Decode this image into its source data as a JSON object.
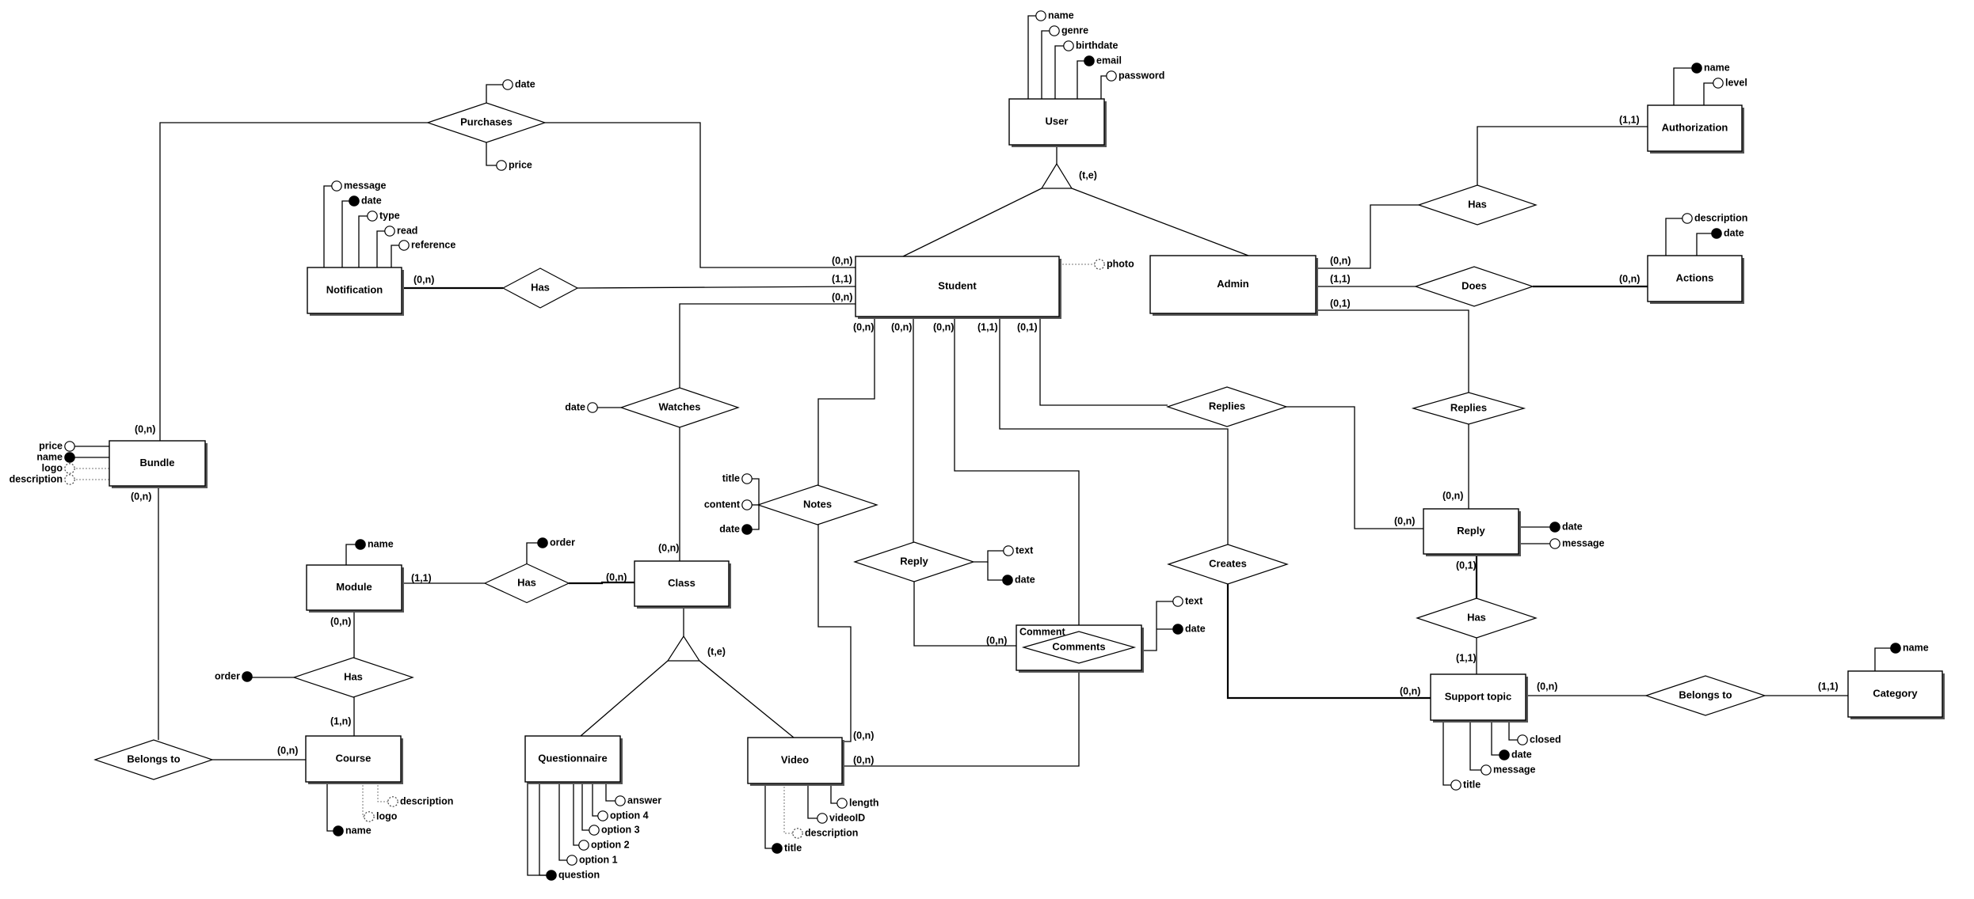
{
  "diagram": {
    "type": "Entity-Relationship diagram",
    "entities": {
      "user": "User",
      "student": "Student",
      "admin": "Admin",
      "authorization": "Authorization",
      "actions": "Actions",
      "notification": "Notification",
      "bundle": "Bundle",
      "module": "Module",
      "class": "Class",
      "course": "Course",
      "questionnaire": "Questionnaire",
      "video": "Video",
      "reply": "Reply",
      "support_topic": "Support topic",
      "category": "Category",
      "comment": "Comment"
    },
    "relationships": {
      "purchases": "Purchases",
      "has_notification": "Has",
      "watches": "Watches",
      "notes": "Notes",
      "has_module_class": "Has",
      "has_module_course": "Has",
      "belongs_to_bundle": "Belongs to",
      "reply_comment": "Reply",
      "comments": "Comments",
      "replies_student": "Replies",
      "replies_admin": "Replies",
      "creates": "Creates",
      "has_authorization": "Has",
      "does": "Does",
      "has_reply_topic": "Has",
      "belongs_to_category": "Belongs to"
    },
    "specializations": {
      "user": "(t,e)",
      "class": "(t,e)"
    },
    "attributes": {
      "user": [
        {
          "name": "name",
          "kind": "normal"
        },
        {
          "name": "genre",
          "kind": "normal"
        },
        {
          "name": "birthdate",
          "kind": "normal"
        },
        {
          "name": "email",
          "kind": "key"
        },
        {
          "name": "password",
          "kind": "normal"
        }
      ],
      "student": [
        {
          "name": "photo",
          "kind": "optional"
        }
      ],
      "authorization": [
        {
          "name": "name",
          "kind": "key"
        },
        {
          "name": "level",
          "kind": "normal"
        }
      ],
      "actions": [
        {
          "name": "description",
          "kind": "normal"
        },
        {
          "name": "date",
          "kind": "key"
        }
      ],
      "purchases": [
        {
          "name": "date",
          "kind": "normal"
        },
        {
          "name": "price",
          "kind": "normal"
        }
      ],
      "notification": [
        {
          "name": "message",
          "kind": "normal"
        },
        {
          "name": "date",
          "kind": "key"
        },
        {
          "name": "type",
          "kind": "normal"
        },
        {
          "name": "read",
          "kind": "normal"
        },
        {
          "name": "reference",
          "kind": "normal"
        }
      ],
      "bundle": [
        {
          "name": "price",
          "kind": "normal"
        },
        {
          "name": "name",
          "kind": "key"
        },
        {
          "name": "logo",
          "kind": "optional"
        },
        {
          "name": "description",
          "kind": "optional"
        }
      ],
      "watches": [
        {
          "name": "date",
          "kind": "normal"
        }
      ],
      "notes": [
        {
          "name": "title",
          "kind": "normal"
        },
        {
          "name": "content",
          "kind": "normal"
        },
        {
          "name": "date",
          "kind": "key"
        }
      ],
      "module": [
        {
          "name": "name",
          "kind": "key"
        }
      ],
      "has_module_class": [
        {
          "name": "order",
          "kind": "key"
        }
      ],
      "has_module_course": [
        {
          "name": "order",
          "kind": "key"
        }
      ],
      "course": [
        {
          "name": "description",
          "kind": "optional"
        },
        {
          "name": "logo",
          "kind": "optional"
        },
        {
          "name": "name",
          "kind": "key"
        }
      ],
      "questionnaire": [
        {
          "name": "answer",
          "kind": "normal"
        },
        {
          "name": "option 4",
          "kind": "normal"
        },
        {
          "name": "option 3",
          "kind": "normal"
        },
        {
          "name": "option 2",
          "kind": "normal"
        },
        {
          "name": "option 1",
          "kind": "normal"
        },
        {
          "name": "question",
          "kind": "key"
        }
      ],
      "video": [
        {
          "name": "length",
          "kind": "normal"
        },
        {
          "name": "videoID",
          "kind": "normal"
        },
        {
          "name": "description",
          "kind": "optional"
        },
        {
          "name": "title",
          "kind": "key"
        }
      ],
      "reply_comment": [
        {
          "name": "text",
          "kind": "normal"
        },
        {
          "name": "date",
          "kind": "key"
        }
      ],
      "comments": [
        {
          "name": "text",
          "kind": "normal"
        },
        {
          "name": "date",
          "kind": "key"
        }
      ],
      "reply": [
        {
          "name": "date",
          "kind": "key"
        },
        {
          "name": "message",
          "kind": "normal"
        }
      ],
      "support_topic": [
        {
          "name": "closed",
          "kind": "normal"
        },
        {
          "name": "date",
          "kind": "key"
        },
        {
          "name": "message",
          "kind": "normal"
        },
        {
          "name": "title",
          "kind": "normal"
        }
      ],
      "category": [
        {
          "name": "name",
          "kind": "key"
        }
      ]
    },
    "cardinalities": {
      "student_purchases": "(0,n)",
      "student_has_notification": "(1,1)",
      "student_watches": "(0,n)",
      "student_notes": "(0,n)",
      "student_reply": "(0,n)",
      "student_comments": "(0,n)",
      "student_creates": "(1,1)",
      "student_replies": "(0,1)",
      "notification_has": "(0,n)",
      "bundle_purchases": "(0,n)",
      "bundle_belongs_to": "(0,n)",
      "course_belongs_to": "(0,n)",
      "module_has_class": "(1,1)",
      "class_has_module": "(0,n)",
      "class_watches": "(0,n)",
      "module_has_course": "(0,n)",
      "course_has_module": "(1,n)",
      "video_notes": "(0,n)",
      "video_comments": "(0,n)",
      "comment_reply": "(0,n)",
      "admin_has": "(0,n)",
      "admin_does": "(1,1)",
      "admin_replies": "(0,1)",
      "authorization_has": "(1,1)",
      "actions_does": "(0,n)",
      "reply_replies_admin": "(0,n)",
      "reply_replies_student": "(0,n)",
      "reply_has": "(0,1)",
      "topic_has": "(1,1)",
      "topic_creates": "(0,n)",
      "topic_belongs_to": "(0,n)",
      "category_belongs_to": "(1,1)"
    }
  }
}
